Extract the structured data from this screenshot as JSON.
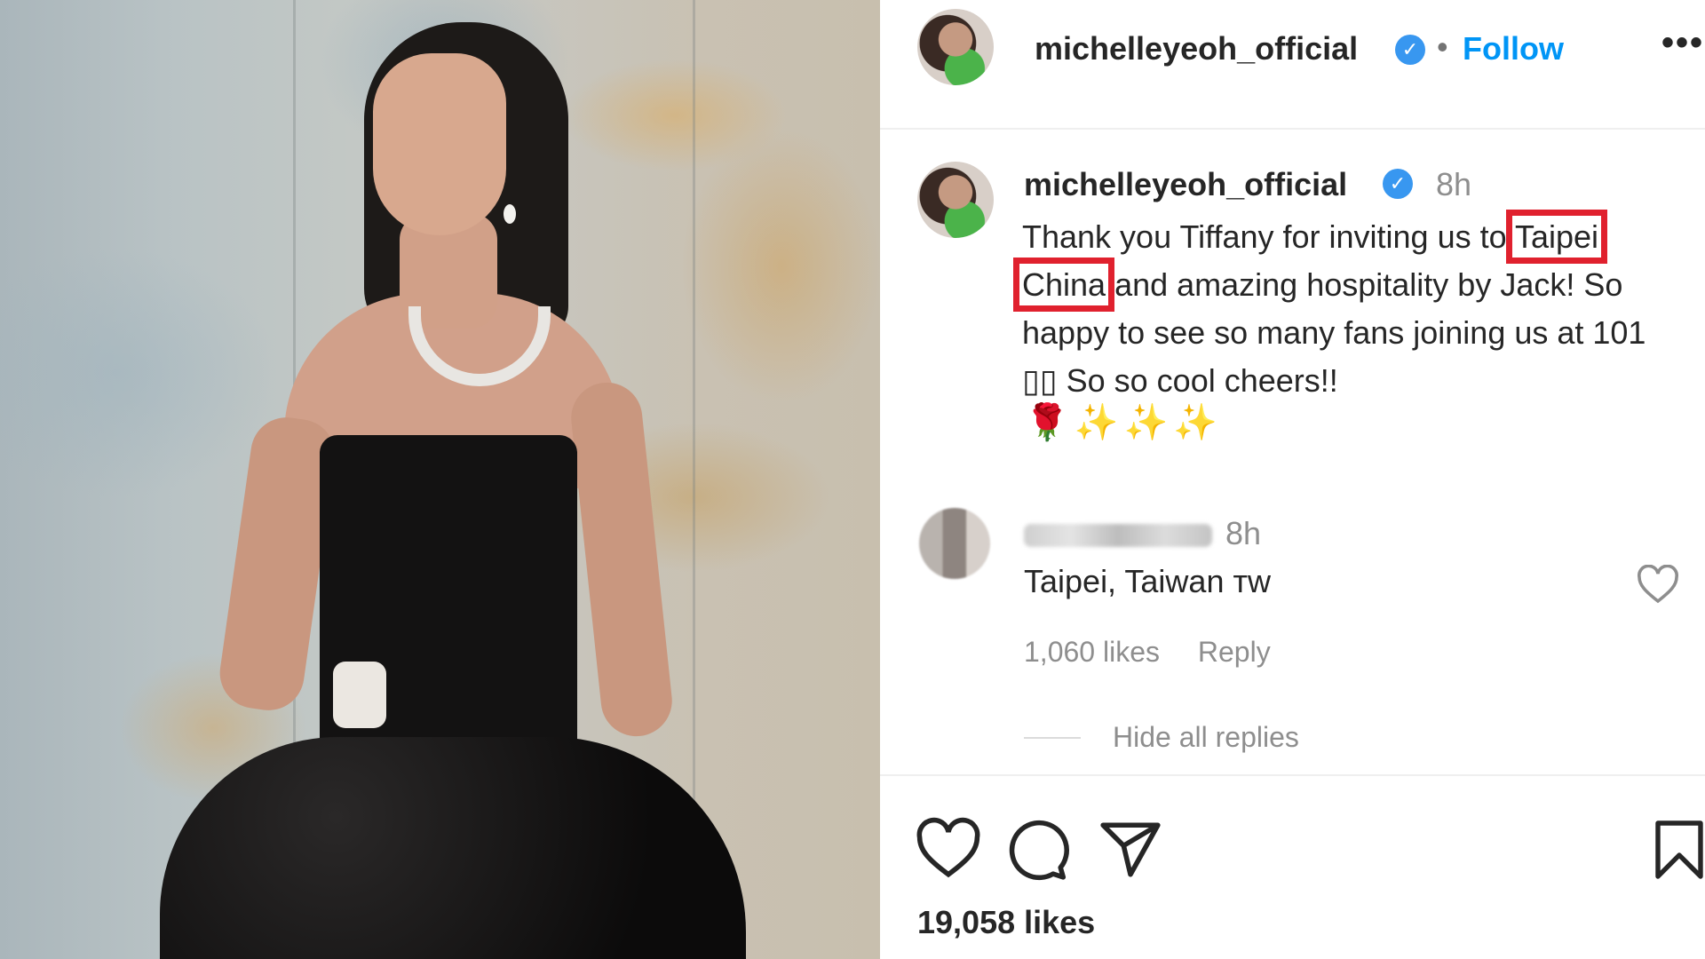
{
  "header": {
    "username": "michelleyeoh_official",
    "separator": "•",
    "follow_label": "Follow",
    "more_label": "•••"
  },
  "caption": {
    "username": "michelleyeoh_official",
    "time": "8h",
    "text_before": "Thank you Tiffany for inviting us to ",
    "highlighted": "Taipei China",
    "text_after": " and amazing hospitality by Jack! So happy to see so many fans joining us at 101 ▯▯ So so cool cheers!!",
    "emojis": "🌹✨✨✨"
  },
  "comment": {
    "time": "8h",
    "text": "Taipei, Taiwan ᴛᴡ",
    "likes": "1,060 likes",
    "reply_label": "Reply",
    "hide_replies_label": "Hide all replies"
  },
  "post": {
    "likes": "19,058 likes"
  },
  "colors": {
    "link": "#0095f6",
    "verified": "#3897f0",
    "highlight_box": "#e0212e"
  },
  "icons": [
    "verified-badge-icon",
    "more-options-icon",
    "heart-icon",
    "comment-icon",
    "share-icon",
    "bookmark-icon",
    "comment-like-icon"
  ]
}
